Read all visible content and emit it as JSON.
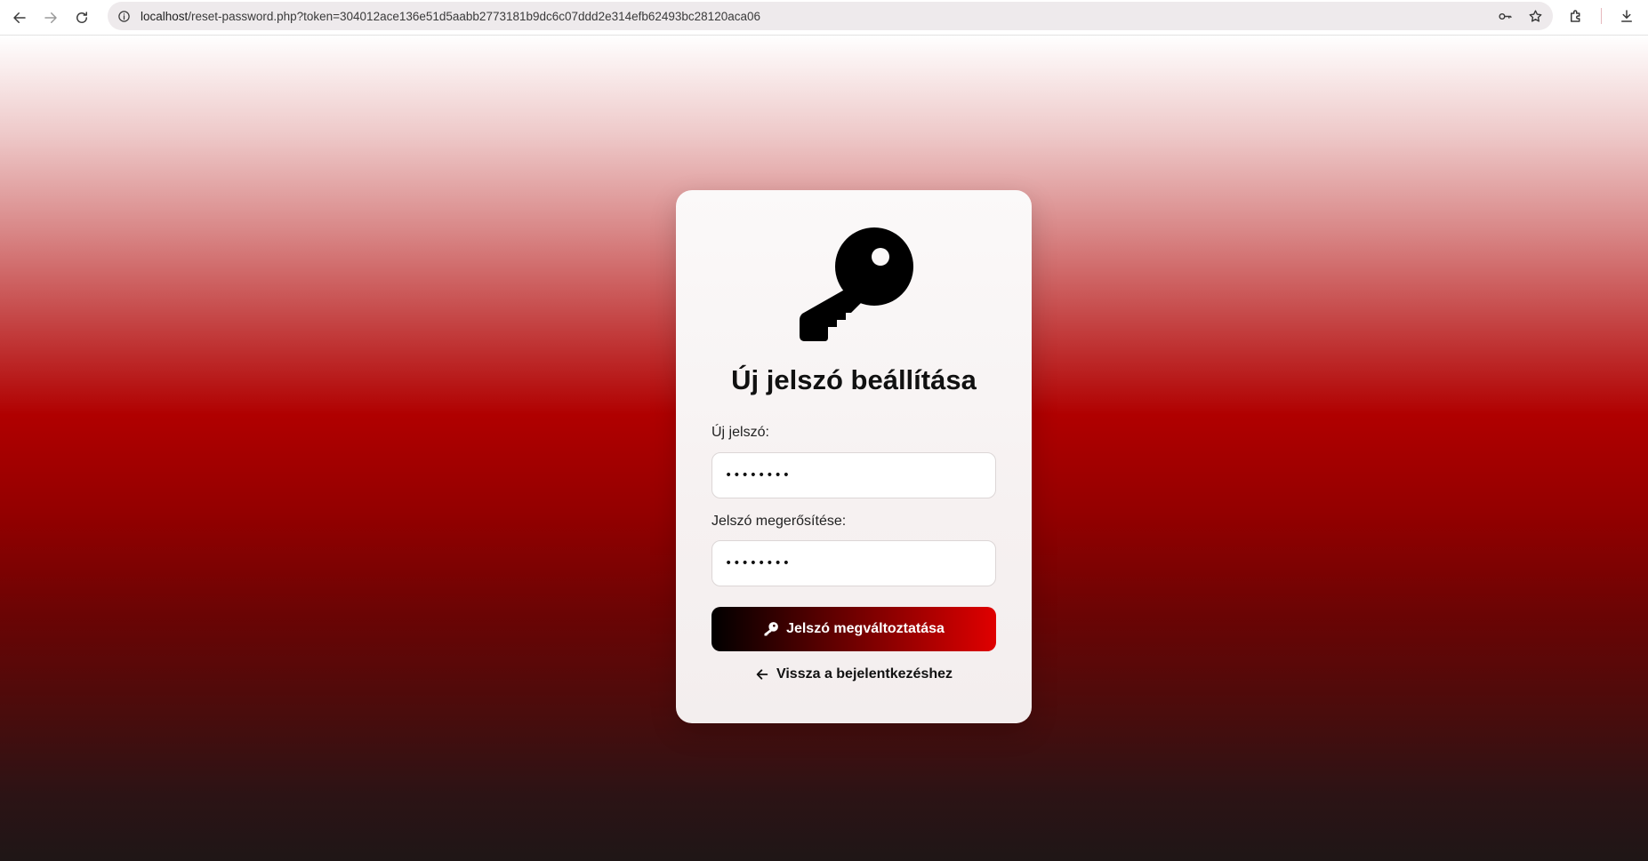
{
  "browser": {
    "url_host": "localhost",
    "url_path": "/reset-password.php?token=304012ace136e51d5aabb2773181b9dc6c07ddd2e314efb62493bc28120aca06"
  },
  "icons": {
    "back": "arrow-left-icon",
    "forward": "arrow-right-icon",
    "reload": "reload-icon",
    "site_info": "info-icon",
    "password_manager": "key-icon",
    "bookmark": "star-icon",
    "extensions": "puzzle-icon",
    "downloads": "download-icon",
    "hero": "key-icon",
    "submit": "key-icon",
    "back_link": "arrow-left-icon"
  },
  "form": {
    "title": "Új jelszó beállítása",
    "new_password_label": "Új jelszó:",
    "new_password_value": "••••••••",
    "confirm_password_label": "Jelszó megerősítése:",
    "confirm_password_value": "••••••••",
    "submit_label": "Jelszó megváltoztatása",
    "back_label": "Vissza a bejelentkezéshez"
  },
  "colors": {
    "accent_red": "#e00000",
    "dark": "#000000"
  }
}
